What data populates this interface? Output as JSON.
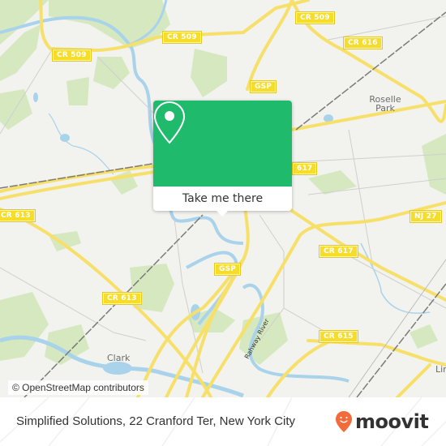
{
  "map": {
    "road_labels": [
      {
        "id": "cr509-top",
        "text": "CR 509"
      },
      {
        "id": "cr509-left",
        "text": "CR 509"
      },
      {
        "id": "cr509-right",
        "text": "CR 509"
      },
      {
        "id": "cr616",
        "text": "CR 616"
      },
      {
        "id": "gsp-north",
        "text": "GSP"
      },
      {
        "id": "cr617-north",
        "text": "617"
      },
      {
        "id": "cr613-left",
        "text": "CR 613"
      },
      {
        "id": "nj27",
        "text": "NJ 27"
      },
      {
        "id": "cr617-south",
        "text": "CR 617"
      },
      {
        "id": "gsp-south",
        "text": "GSP"
      },
      {
        "id": "cr613-center",
        "text": "CR 613"
      },
      {
        "id": "cr615",
        "text": "CR 615"
      }
    ],
    "places": {
      "roselle_park_line1": "Roselle",
      "roselle_park_line2": "Park",
      "clark": "Clark",
      "linden_partial": "Lin"
    },
    "water_labels": {
      "rahway_river": "Rahway River"
    },
    "attribution": "© OpenStreetMap contributors"
  },
  "popup": {
    "icon": "map-pin-icon",
    "button_label": "Take me there",
    "accent_color": "#1fba6c"
  },
  "footer": {
    "title": "Simplified Solutions, 22 Cranford Ter, New York City",
    "brand": "moovit",
    "brand_color": "#f26b3a"
  }
}
